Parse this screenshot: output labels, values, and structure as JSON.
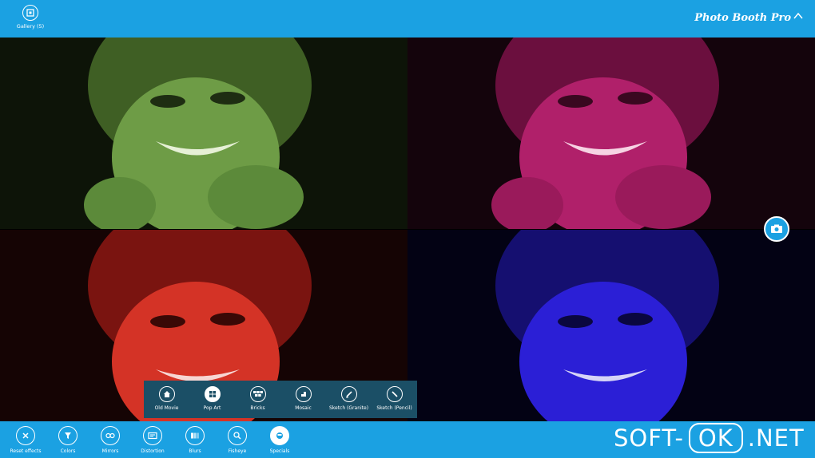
{
  "topbar": {
    "gallery_label": "Gallery (5)",
    "app_title": "Photo Booth Pro",
    "chevron": "^"
  },
  "panels": [
    {
      "name": "green",
      "tint": "#5c8a3a"
    },
    {
      "name": "magenta",
      "tint": "#b0206a"
    },
    {
      "name": "red",
      "tint": "#c8261f"
    },
    {
      "name": "blue",
      "tint": "#2b1fd6"
    }
  ],
  "capture": {
    "icon": "camera-icon"
  },
  "effects": [
    {
      "label": "Old Movie",
      "icon": "house-icon"
    },
    {
      "label": "Pop Art",
      "icon": "grid-icon",
      "selected": true
    },
    {
      "label": "Bricks",
      "icon": "bricks-icon"
    },
    {
      "label": "Mosaic",
      "icon": "mosaic-icon"
    },
    {
      "label": "Sketch (Granite)",
      "icon": "pen-icon"
    },
    {
      "label": "Sketch (Pencil)",
      "icon": "pencil-icon"
    }
  ],
  "bottom": [
    {
      "label": "Reset effects",
      "icon": "close-icon"
    },
    {
      "label": "Colors",
      "icon": "filter-icon"
    },
    {
      "label": "Mirrors",
      "icon": "mirror-icon"
    },
    {
      "label": "Distortion",
      "icon": "distortion-icon"
    },
    {
      "label": "Blurs",
      "icon": "blur-icon"
    },
    {
      "label": "Fisheye",
      "icon": "magnifier-icon"
    },
    {
      "label": "Specials",
      "icon": "specials-icon",
      "selected": true
    }
  ],
  "watermark": {
    "left": "SOFT-",
    "ok": "OK",
    "right": ".NET"
  }
}
